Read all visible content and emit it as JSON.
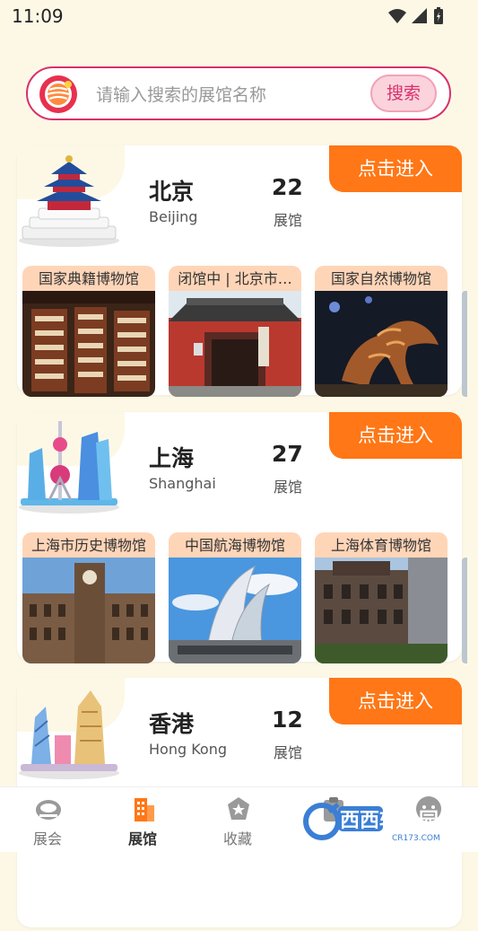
{
  "status": {
    "time": "11:09"
  },
  "search": {
    "placeholder": "请输入搜索的展馆名称",
    "button": "搜索"
  },
  "enter_label": "点击进入",
  "cities": [
    {
      "name": "北京",
      "english": "Beijing",
      "count": "22",
      "count_label": "展馆",
      "museums": [
        "国家典籍博物馆",
        "闭馆中 | 北京市…",
        "国家自然博物馆"
      ]
    },
    {
      "name": "上海",
      "english": "Shanghai",
      "count": "27",
      "count_label": "展馆",
      "museums": [
        "上海市历史博物馆",
        "中国航海博物馆",
        "上海体育博物馆"
      ]
    },
    {
      "name": "香港",
      "english": "Hong Kong",
      "count": "12",
      "count_label": "展馆",
      "museums": []
    }
  ],
  "tabs": [
    {
      "label": "展会",
      "icon": "exhibition-icon",
      "active": false
    },
    {
      "label": "展馆",
      "icon": "museum-building-icon",
      "active": true
    },
    {
      "label": "收藏",
      "icon": "star-icon",
      "active": false
    },
    {
      "label": "",
      "icon": "clipboard-icon",
      "active": false
    },
    {
      "label": "",
      "icon": "profile-icon",
      "active": false
    }
  ],
  "watermark": {
    "text": "西西软件园",
    "sub": "CR173.COM"
  },
  "colors": {
    "accent": "#ff7716",
    "search_border": "#d9306d",
    "background": "#fdf8e6",
    "label_bg": "#ffd5b8"
  }
}
